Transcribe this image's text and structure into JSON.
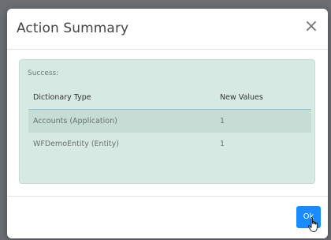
{
  "dialog": {
    "title": "Action Summary",
    "close_icon": "close-icon",
    "alert": {
      "label": "Success:",
      "columns": [
        "Dictionary Type",
        "New Values"
      ],
      "rows": [
        {
          "type": "Accounts (Application)",
          "new_values": "1"
        },
        {
          "type": "WFDemoEntity (Entity)",
          "new_values": "1"
        }
      ]
    },
    "ok_label": "Ok"
  },
  "colors": {
    "primary": "#1a8cff",
    "alert_bg": "#d6eae3",
    "alert_row_stripe": "#c6ddd5"
  }
}
